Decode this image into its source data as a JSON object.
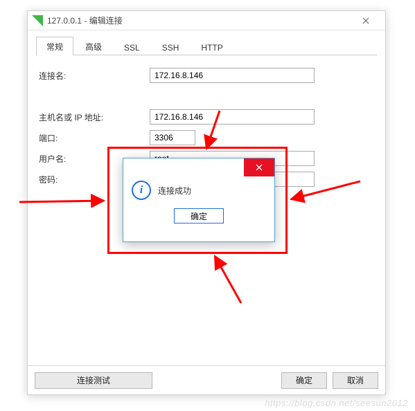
{
  "window": {
    "title": "127.0.0.1 - 编辑连接"
  },
  "tabs": {
    "t0": "常规",
    "t1": "高级",
    "t2": "SSL",
    "t3": "SSH",
    "t4": "HTTP"
  },
  "labels": {
    "conn_name": "连接名:",
    "host": "主机名或 IP 地址:",
    "port": "端口:",
    "user": "用户名:",
    "password": "密码:"
  },
  "values": {
    "conn_name": "172.16.8.146",
    "host": "172.16.8.146",
    "port": "3306",
    "user": "root",
    "password": "•••••••"
  },
  "buttons": {
    "test": "连接测试",
    "ok": "确定",
    "cancel": "取消"
  },
  "modal": {
    "message": "连接成功",
    "ok": "确定",
    "icon_glyph": "i"
  },
  "watermark": "https://blog.csdn.net/seesun2012"
}
